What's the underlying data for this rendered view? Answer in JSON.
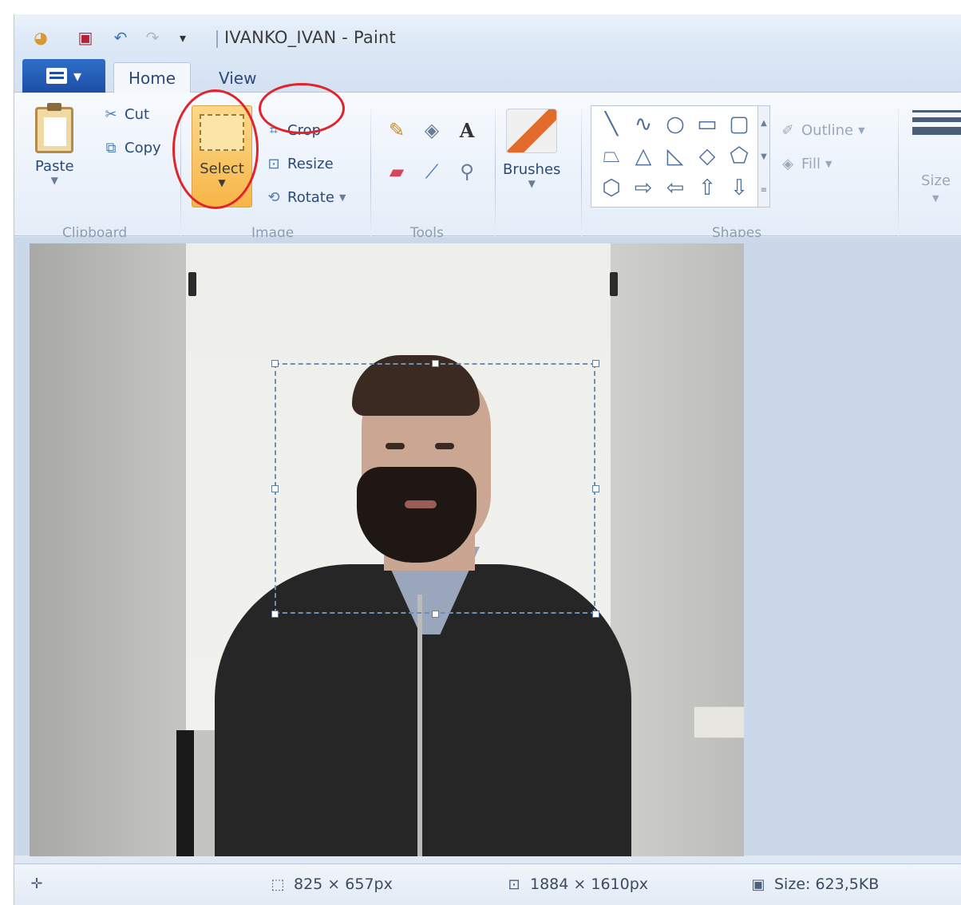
{
  "window": {
    "title": "IVANKO_IVAN - Paint"
  },
  "quick_access": [
    {
      "icon": "paint-app-icon"
    },
    {
      "icon": "save-icon"
    },
    {
      "icon": "undo-icon"
    },
    {
      "icon": "redo-icon"
    },
    {
      "icon": "customize-quick-access-icon"
    }
  ],
  "tabs": {
    "home": "Home",
    "view": "View"
  },
  "ribbon": {
    "clipboard": {
      "label": "Clipboard",
      "paste": "Paste",
      "cut": "Cut",
      "copy": "Copy"
    },
    "image": {
      "label": "Image",
      "select": "Select",
      "crop": "Crop",
      "resize": "Resize",
      "rotate": "Rotate"
    },
    "tools": {
      "label": "Tools",
      "items": [
        "pencil-icon",
        "fill-icon",
        "text-icon",
        "eraser-icon",
        "color-picker-icon",
        "magnifier-icon"
      ]
    },
    "brushes": {
      "label": "Brushes"
    },
    "shapes": {
      "label": "Shapes",
      "outline": "Outline",
      "fill": "Fill",
      "items": [
        "line-icon",
        "curve-icon",
        "oval-icon",
        "rectangle-icon",
        "rounded-rectangle-icon",
        "polygon-icon",
        "triangle-icon",
        "right-triangle-icon",
        "diamond-icon",
        "pentagon-icon",
        "hexagon-icon",
        "right-arrow-icon",
        "left-arrow-icon",
        "up-arrow-icon",
        "down-arrow-icon"
      ]
    },
    "size": {
      "label": "Size"
    }
  },
  "statusbar": {
    "selection_size": "825 × 657px",
    "image_size": "1884 × 1610px",
    "file_size": "Size: 623,5KB"
  },
  "colors": {
    "select_highlight": "#f7b548",
    "annotation_red": "#e0242b",
    "app_menu_blue": "#1c4fa6"
  }
}
